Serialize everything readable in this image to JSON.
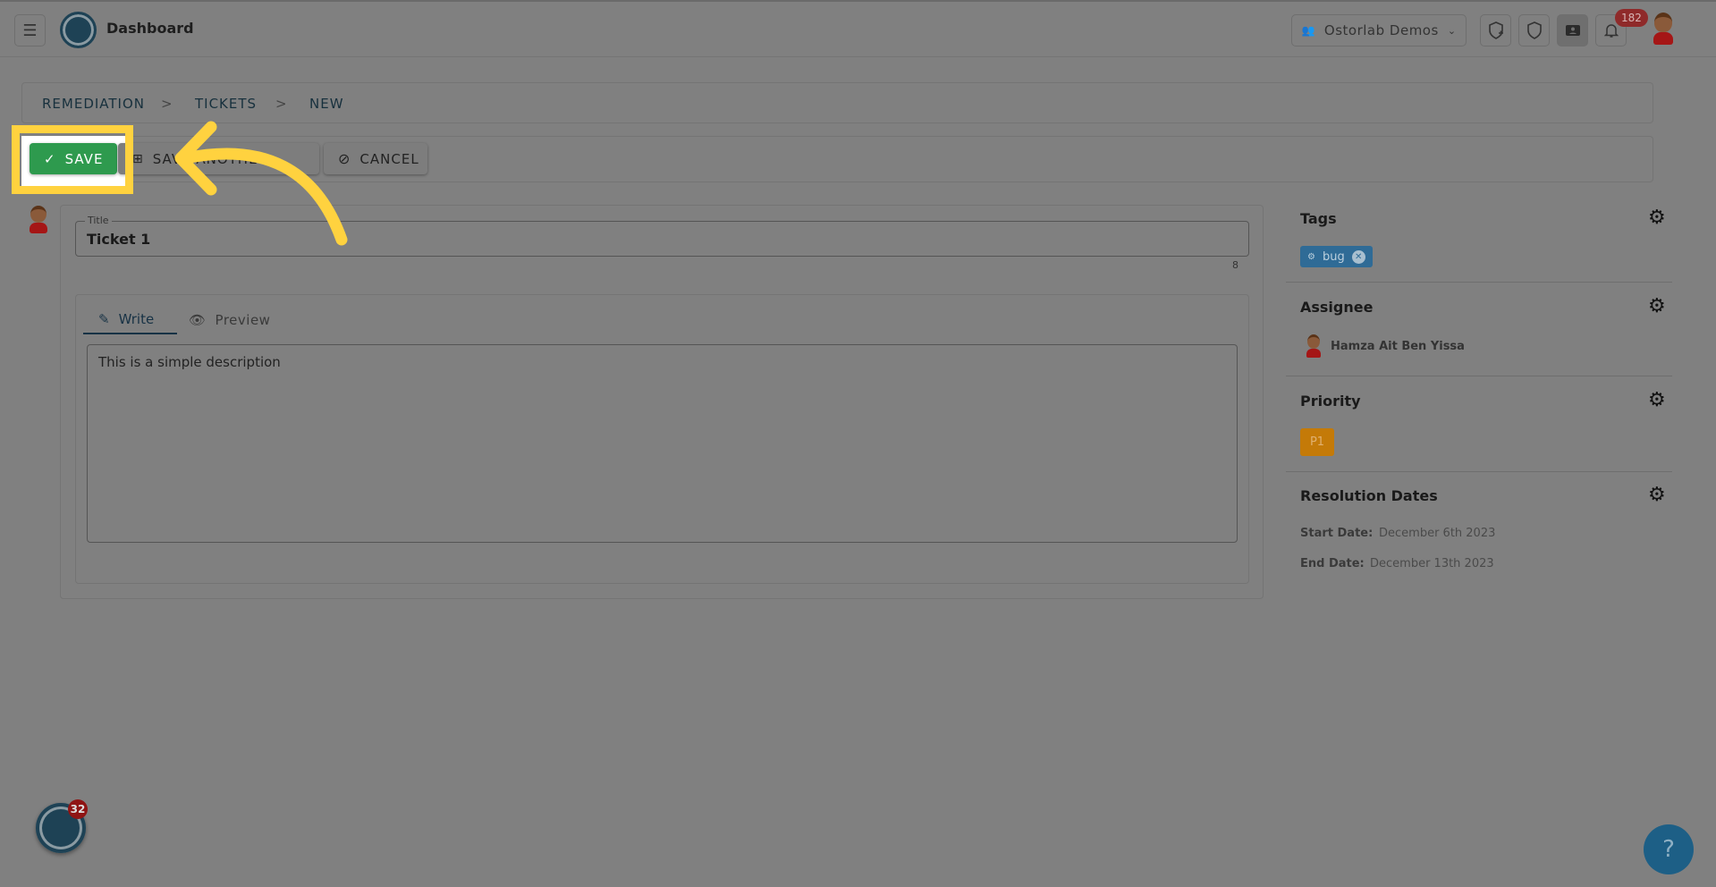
{
  "header": {
    "title": "Dashboard",
    "org": "Ostorlab Demos",
    "notifications": "182"
  },
  "breadcrumb": [
    "REMEDIATION",
    "TICKETS",
    "NEW"
  ],
  "toolbar": {
    "save": "SAVE",
    "save_another": "SAVE ANOTHER",
    "cancel": "CANCEL"
  },
  "form": {
    "title_label": "Title",
    "title_value": "Ticket 1",
    "char_count": "8",
    "tabs": [
      "Write",
      "Preview"
    ],
    "description": "This is a simple description"
  },
  "side": {
    "tags_title": "Tags",
    "tags": [
      "bug"
    ],
    "assignee_title": "Assignee",
    "assignee": "Hamza Ait Ben Yissa",
    "priority_title": "Priority",
    "priority": "P1",
    "dates_title": "Resolution Dates",
    "start_label": "Start Date:",
    "start": "December 6th 2023",
    "end_label": "End Date:",
    "end": "December 13th 2023"
  },
  "chat": {
    "badge": "32"
  },
  "help": {
    "label": "?"
  },
  "colors": {
    "save": "#2e9a4e",
    "highlight": "#ffd23f",
    "tag": "#2f6b96",
    "priority": "#c47a08",
    "help": "#1d5f86"
  }
}
